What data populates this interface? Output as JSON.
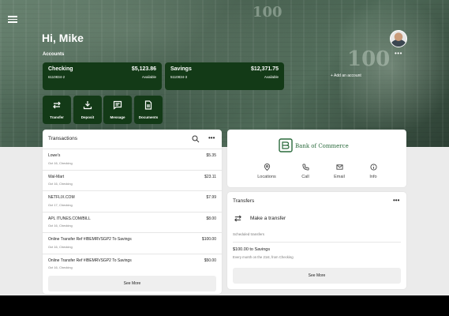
{
  "header": {
    "greeting": "Hi, Mike",
    "accounts_label": "Accounts",
    "more_label": "•••",
    "add_account_label": "+ Add an account"
  },
  "accounts": [
    {
      "name": "Checking",
      "number": "6110834-2",
      "balance": "$5,123.86",
      "status": "Available"
    },
    {
      "name": "Savings",
      "number": "5110834-3",
      "balance": "$12,371.75",
      "status": "Available"
    }
  ],
  "actions": [
    {
      "label": "Transfer",
      "icon": "transfer-icon"
    },
    {
      "label": "Deposit",
      "icon": "download-icon"
    },
    {
      "label": "Message",
      "icon": "message-icon"
    },
    {
      "label": "Documents",
      "icon": "document-icon"
    }
  ],
  "transactions": {
    "title": "Transactions",
    "more_label": "•••",
    "items": [
      {
        "name": "Lowe's",
        "date": "Oct 16, Checking",
        "amount": "$5.35"
      },
      {
        "name": "Wal-Mart",
        "date": "Oct 16, Checking",
        "amount": "$23.11"
      },
      {
        "name": "NETFLIX.COM",
        "date": "Oct 17, Checking",
        "amount": "$7.99"
      },
      {
        "name": "APL ITUNES.COM/BILL",
        "date": "Oct 16, Checking",
        "amount": "$8.00"
      },
      {
        "name": "Online Transfer Ref #IBEMRVSGP2 To Savings",
        "date": "Oct 16, Checking",
        "amount": "$100.00"
      },
      {
        "name": "Online Transfer Ref #IBEMRVSGP2 To Savings",
        "date": "Oct 16, Checking",
        "amount": "$50.00"
      }
    ],
    "see_more": "See More"
  },
  "bank": {
    "name": "Bank of Commerce",
    "brand_color": "#2a6a3c",
    "actions": [
      {
        "label": "Locations",
        "icon": "location-pin-icon"
      },
      {
        "label": "Call",
        "icon": "phone-icon"
      },
      {
        "label": "Email",
        "icon": "email-icon"
      },
      {
        "label": "Info",
        "icon": "info-icon"
      }
    ]
  },
  "transfers": {
    "title": "Transfers",
    "more_label": "•••",
    "make_transfer": "Make a transfer",
    "scheduled_label": "Scheduled transfers",
    "scheduled": [
      {
        "title": "$100.00 to Savings",
        "subtitle": "Every month on the 21st, from Checking"
      }
    ],
    "see_more": "See More"
  },
  "colors": {
    "primary": "#133a17",
    "background": "#ebebeb"
  }
}
